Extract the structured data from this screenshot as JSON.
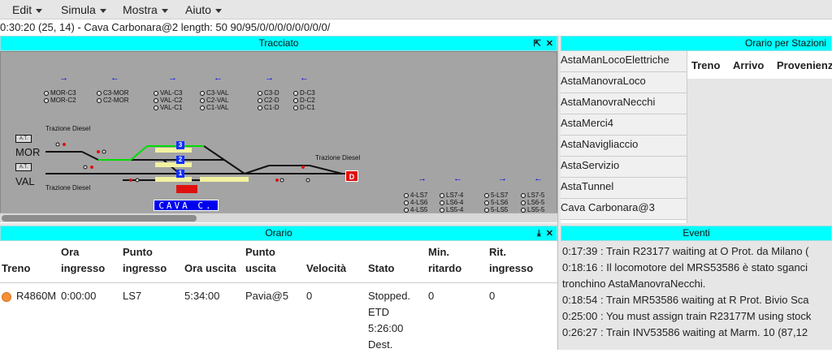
{
  "menu": [
    {
      "label": "Edit"
    },
    {
      "label": "Simula"
    },
    {
      "label": "Mostra"
    },
    {
      "label": "Aiuto"
    }
  ],
  "status_line": "0:30:20 (25, 14) - Cava Carbonara@2 length: 50 90/95/0/0/0/0/0/0/0/0/",
  "panels": {
    "tracciato": "Tracciato",
    "orario_stazioni": "Orario per Stazioni",
    "orario": "Orario",
    "eventi": "Eventi"
  },
  "track": {
    "signal_groups": [
      [
        "MOR-C3",
        "MOR-C2"
      ],
      [
        "C3-MOR",
        "C2-MOR"
      ],
      [
        "VAL-C3",
        "VAL-C2",
        "VAL-C1"
      ],
      [
        "C3-VAL",
        "C2-VAL",
        "C1-VAL"
      ],
      [
        "C3-D",
        "C2-D",
        "C1-D"
      ],
      [
        "D-C3",
        "D-C2",
        "D-C1"
      ],
      [
        "4-LS7",
        "4-LS6",
        "4-LS5"
      ],
      [
        "LS7-4",
        "LS6-4",
        "LS5-4"
      ],
      [
        "5-LS7",
        "5-LS6",
        "5-LS5"
      ],
      [
        "LS7-5",
        "LS6-5",
        "LS5-5"
      ]
    ],
    "trazione_left_top": "Trazione Diesel",
    "trazione_left_bottom": "Trazione Diesel",
    "trazione_right": "Trazione Diesel",
    "at_label": "A.T.",
    "mor": "MOR",
    "val": "VAL",
    "station_sign": "CAVA C.",
    "d_sign": "D",
    "track_numbers": [
      "3",
      "2",
      "1"
    ],
    "colors": {
      "bg": "#a4a4a4",
      "route": "#00dd00",
      "accent": "#00ffff",
      "sign": "#0000ee"
    }
  },
  "stations": [
    "AstaManLocoElettriche",
    "AstaManovraLoco",
    "AstaManovraNecchi",
    "AstaMerci4",
    "AstaNavigliaccio",
    "AstaServizio",
    "AstaTunnel",
    "Cava Carbonara@3"
  ],
  "station_schedule": {
    "columns": [
      "Treno",
      "Arrivo",
      "Provenienza"
    ]
  },
  "orario": {
    "columns": [
      [
        "Treno"
      ],
      [
        "Ora",
        "ingresso"
      ],
      [
        "Punto",
        "ingresso"
      ],
      [
        "Ora uscita"
      ],
      [
        "Punto",
        "uscita"
      ],
      [
        "Velocità"
      ],
      [
        "Stato"
      ],
      [
        "Min.",
        "ritardo"
      ],
      [
        "Rit.",
        "ingresso"
      ]
    ],
    "row": {
      "treno": "R4860M",
      "ora_ingresso": "0:00:00",
      "punto_ingresso": "LS7",
      "ora_uscita": "5:34:00",
      "punto_uscita": "Pavia@5",
      "velocita": "0",
      "stato": [
        "Stopped.",
        "ETD",
        "5:26:00",
        "Dest."
      ],
      "min_ritardo": "0",
      "rit_ingresso": "0",
      "status_color": "#f59036"
    }
  },
  "events": [
    "0:17:39 : Train R23177 waiting at O Prot. da Milano (",
    "0:18:16 : Il locomotore del MRS53586 è stato sganci",
    "tronchino AstaManovraNecchi.",
    "0:18:54 : Train MR53586 waiting at R Prot. Bivio Sca",
    "0:25:00 : You must assign train R23177M using stock",
    "0:26:27 : Train INV53586 waiting at Marm. 10 (87,12"
  ]
}
